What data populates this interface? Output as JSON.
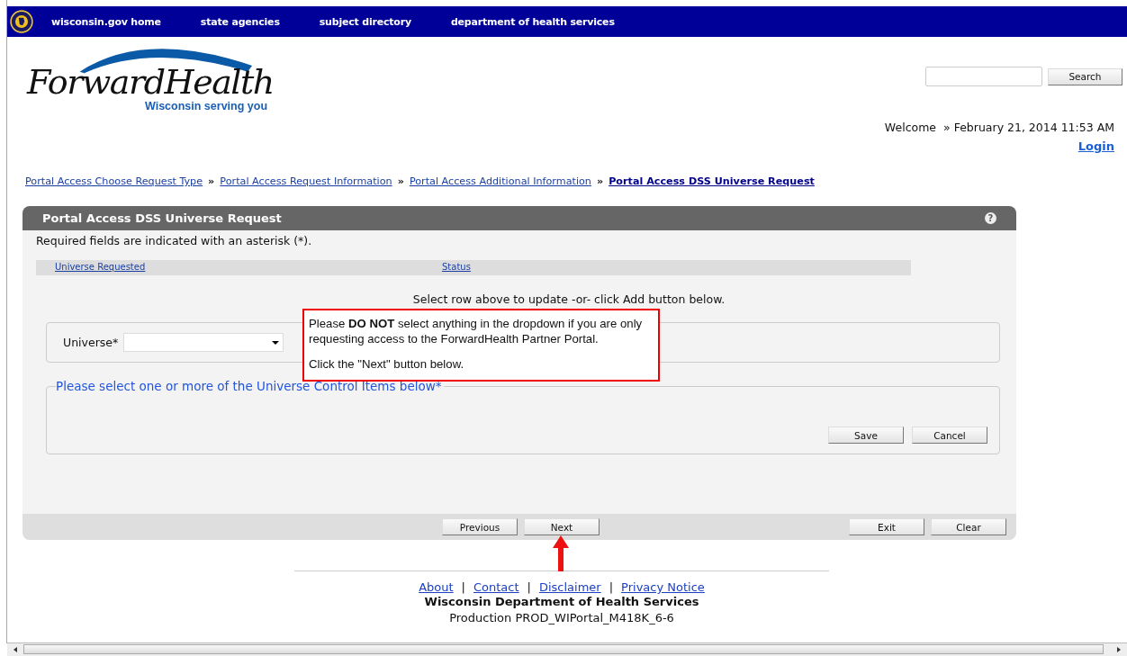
{
  "top_nav": [
    "wisconsin.gov home",
    "state agencies",
    "subject directory",
    "department of health services"
  ],
  "logo": {
    "name": "ForwardHealth",
    "tagline": "Wisconsin serving you"
  },
  "search": {
    "button": "Search"
  },
  "welcome": {
    "label": "Welcome",
    "datetime": "» February 21, 2014 11:53 AM",
    "login": "Login"
  },
  "breadcrumb": [
    {
      "label": "Portal Access Choose Request Type",
      "current": false
    },
    {
      "label": "Portal Access Request Information",
      "current": false
    },
    {
      "label": "Portal Access Additional Information",
      "current": false
    },
    {
      "label": "Portal Access DSS Universe Request",
      "current": true
    }
  ],
  "breadcrumb_separators": [
    "»",
    "»",
    "»"
  ],
  "panel": {
    "title": "Portal Access DSS Universe Request",
    "help": "?",
    "required_note": "Required fields are indicated with an asterisk (*).",
    "columns": [
      "Universe Requested",
      "Status"
    ],
    "instruction": "Select row above to update -or- click Add button below.",
    "universe_label": "Universe*",
    "control_items_legend": "Please select one or more of the Universe Control Items below*",
    "section_buttons": [
      "Save",
      "Cancel"
    ],
    "nav_buttons": [
      "Previous",
      "Next"
    ],
    "right_buttons": [
      "Exit",
      "Clear"
    ]
  },
  "callout": {
    "lines": [
      "Please **DO NOT** select anything in the dropdown if you are only requesting access to the ForwardHealth Partner Portal.",
      "Click the \"Next\" button below."
    ]
  },
  "footer": {
    "links": [
      "About",
      "Contact",
      "Disclaimer",
      "Privacy Notice"
    ],
    "separators": [
      "|",
      "|",
      "|"
    ],
    "organization": "Wisconsin Department of Health Services",
    "build": "Production PROD_WIPortal_M418K_6-6"
  }
}
